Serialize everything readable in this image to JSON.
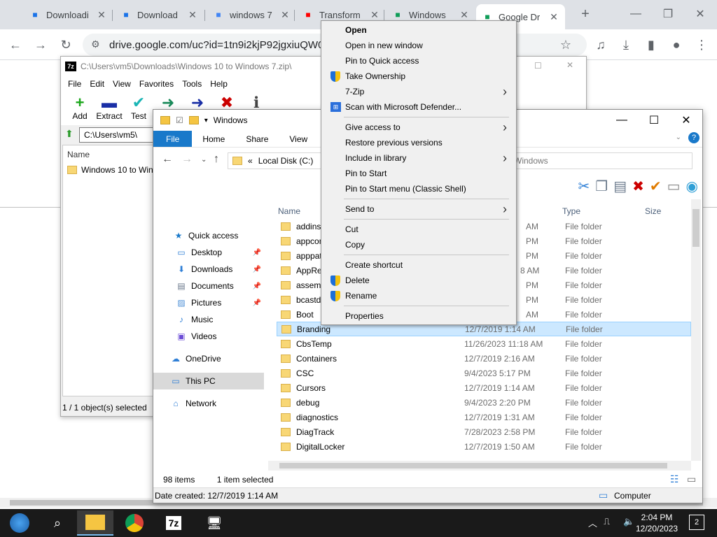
{
  "browser": {
    "tabs": [
      {
        "title": "Downloadi",
        "icon": "page-icon",
        "color": "#1a73e8"
      },
      {
        "title": "Download",
        "icon": "download-icon",
        "color": "#1a73e8"
      },
      {
        "title": "windows 7",
        "icon": "google-icon",
        "color": "#4285f4"
      },
      {
        "title": "Transform",
        "icon": "youtube-icon",
        "color": "#ff0000"
      },
      {
        "title": "Windows",
        "icon": "google-drive-icon",
        "color": "#0f9d58"
      },
      {
        "title": "Google Dr",
        "icon": "google-drive-icon",
        "color": "#0f9d58"
      }
    ],
    "url": "drive.google.com/uc?id=1tn9i2kjP92jgxiuQW0dK"
  },
  "zip": {
    "title": "C:\\Users\\vm5\\Downloads\\Windows 10 to Windows 7.zip\\",
    "app_label": "7z",
    "menu": [
      "File",
      "Edit",
      "View",
      "Favorites",
      "Tools",
      "Help"
    ],
    "toolbar": [
      {
        "label": "Add",
        "glyph": "+",
        "color": "#1aa61a"
      },
      {
        "label": "Extract",
        "glyph": "▬",
        "color": "#1a2fa6"
      },
      {
        "label": "Test",
        "glyph": "✔",
        "color": "#1ab5b5"
      }
    ],
    "address": "C:\\Users\\vm5\\",
    "col_name": "Name",
    "file": "Windows 10 to Wind",
    "status": "1 / 1 object(s) selected"
  },
  "explorer": {
    "title": "Windows",
    "ribbon_tabs": [
      "File",
      "Home",
      "Share",
      "View"
    ],
    "address": "Local Disk (C:)",
    "address_prefix": "«",
    "search_placeholder": "Windows",
    "nav": [
      {
        "label": "Quick access",
        "icon": "star-icon",
        "color": "#1979ca",
        "pinned": false
      },
      {
        "label": "Desktop",
        "icon": "desktop-icon",
        "color": "#2f7fd6",
        "pinned": true
      },
      {
        "label": "Downloads",
        "icon": "download-icon",
        "color": "#2f7fd6",
        "pinned": true
      },
      {
        "label": "Documents",
        "icon": "document-icon",
        "color": "#6b7a8c",
        "pinned": true
      },
      {
        "label": "Pictures",
        "icon": "picture-icon",
        "color": "#4c8fd6",
        "pinned": true
      },
      {
        "label": "Music",
        "icon": "music-icon",
        "color": "#2f7fd6",
        "pinned": false
      },
      {
        "label": "Videos",
        "icon": "video-icon",
        "color": "#6b4cd6",
        "pinned": false
      },
      {
        "label": "OneDrive",
        "icon": "cloud-icon",
        "color": "#2f7fd6",
        "pinned": false
      },
      {
        "label": "This PC",
        "icon": "computer-icon",
        "color": "#2f7fd6",
        "pinned": false
      },
      {
        "label": "Network",
        "icon": "network-icon",
        "color": "#2f7fd6",
        "pinned": false
      }
    ],
    "columns": {
      "name": "Name",
      "type": "Type",
      "size": "Size"
    },
    "files": [
      {
        "name": "addins",
        "date": "AM",
        "type": "File folder"
      },
      {
        "name": "appcom",
        "date": "PM",
        "type": "File folder"
      },
      {
        "name": "apppatc",
        "date": "PM",
        "type": "File folder"
      },
      {
        "name": "AppRea",
        "date": "8 AM",
        "type": "File folder"
      },
      {
        "name": "assemb",
        "date": "PM",
        "type": "File folder"
      },
      {
        "name": "bcastdv",
        "date": "PM",
        "type": "File folder"
      },
      {
        "name": "Boot",
        "date": "AM",
        "type": "File folder"
      },
      {
        "name": "Branding",
        "date": "12/7/2019 1:14 AM",
        "type": "File folder"
      },
      {
        "name": "CbsTemp",
        "date": "11/26/2023 11:18 AM",
        "type": "File folder"
      },
      {
        "name": "Containers",
        "date": "12/7/2019 2:16 AM",
        "type": "File folder"
      },
      {
        "name": "CSC",
        "date": "9/4/2023 5:17 PM",
        "type": "File folder"
      },
      {
        "name": "Cursors",
        "date": "12/7/2019 1:14 AM",
        "type": "File folder"
      },
      {
        "name": "debug",
        "date": "9/4/2023 2:20 PM",
        "type": "File folder"
      },
      {
        "name": "diagnostics",
        "date": "12/7/2019 1:31 AM",
        "type": "File folder"
      },
      {
        "name": "DiagTrack",
        "date": "7/28/2023 2:58 PM",
        "type": "File folder"
      },
      {
        "name": "DigitalLocker",
        "date": "12/7/2019 1:50 AM",
        "type": "File folder"
      }
    ],
    "selected_file": "Branding",
    "item_count": "98 items",
    "selected_count": "1 item selected",
    "date_created": "Date created: 12/7/2019 1:14 AM",
    "computer_label": "Computer"
  },
  "context_menu": [
    {
      "label": "Open",
      "bold": true
    },
    {
      "label": "Open in new window"
    },
    {
      "label": "Pin to Quick access"
    },
    {
      "label": "Take Ownership",
      "shield": true
    },
    {
      "label": "7-Zip",
      "submenu": true
    },
    {
      "label": "Scan with Microsoft Defender...",
      "defender": true
    },
    {
      "sep": true
    },
    {
      "label": "Give access to",
      "submenu": true
    },
    {
      "label": "Restore previous versions"
    },
    {
      "label": "Include in library",
      "submenu": true
    },
    {
      "label": "Pin to Start"
    },
    {
      "label": "Pin to Start menu (Classic Shell)"
    },
    {
      "sep": true
    },
    {
      "label": "Send to",
      "submenu": true
    },
    {
      "sep": true
    },
    {
      "label": "Cut"
    },
    {
      "label": "Copy"
    },
    {
      "sep": true
    },
    {
      "label": "Create shortcut"
    },
    {
      "label": "Delete",
      "shield": true
    },
    {
      "label": "Rename",
      "shield": true
    },
    {
      "sep": true
    },
    {
      "label": "Properties"
    }
  ],
  "taskbar": {
    "time": "2:04 PM",
    "date": "12/20/2023",
    "notif_count": "2",
    "zip_label": "7z"
  }
}
